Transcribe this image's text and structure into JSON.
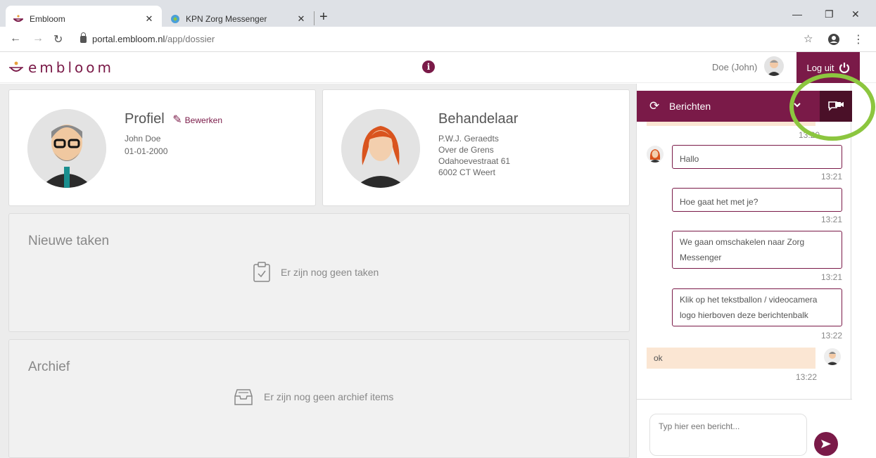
{
  "browser": {
    "tabs": [
      {
        "label": "Embloom"
      },
      {
        "label": "KPN Zorg Messenger"
      }
    ],
    "url_domain": "portal.embloom.nl",
    "url_path": "/app/dossier"
  },
  "app": {
    "logo_text": "embloom",
    "user_label": "Doe (John)",
    "logout_label": "Log uit"
  },
  "profile": {
    "title": "Profiel",
    "edit_label": "Bewerken",
    "name": "John Doe",
    "dob": "01-01-2000"
  },
  "therapist": {
    "title": "Behandelaar",
    "lines": [
      "P.W.J. Geraedts",
      "Over de Grens",
      "Odahoevestraat 61",
      "6002 CT Weert"
    ]
  },
  "tasks": {
    "title": "Nieuwe taken",
    "empty": "Er zijn nog geen taken"
  },
  "archive": {
    "title": "Archief",
    "empty": "Er zijn nog geen archief items"
  },
  "chat": {
    "title": "Berichten",
    "top_time": "13:20",
    "messages": [
      {
        "text": "Hallo",
        "time": "13:21"
      },
      {
        "text": "Hoe gaat het met je?",
        "time": "13:21"
      },
      {
        "text": "We gaan omschakelen naar Zorg Messenger",
        "time": "13:21"
      },
      {
        "text": "Klik op het tekstballon / videocamera logo hierboven deze berichtenbalk",
        "time": "13:22"
      }
    ],
    "self_message": {
      "text": "ok",
      "time": "13:22"
    },
    "input_placeholder": "Typ hier een bericht..."
  },
  "colors": {
    "brand": "#7a1a48",
    "brand_dark": "#4a1028",
    "self_bubble": "#fbe6d3",
    "highlight": "#8cc63f"
  }
}
